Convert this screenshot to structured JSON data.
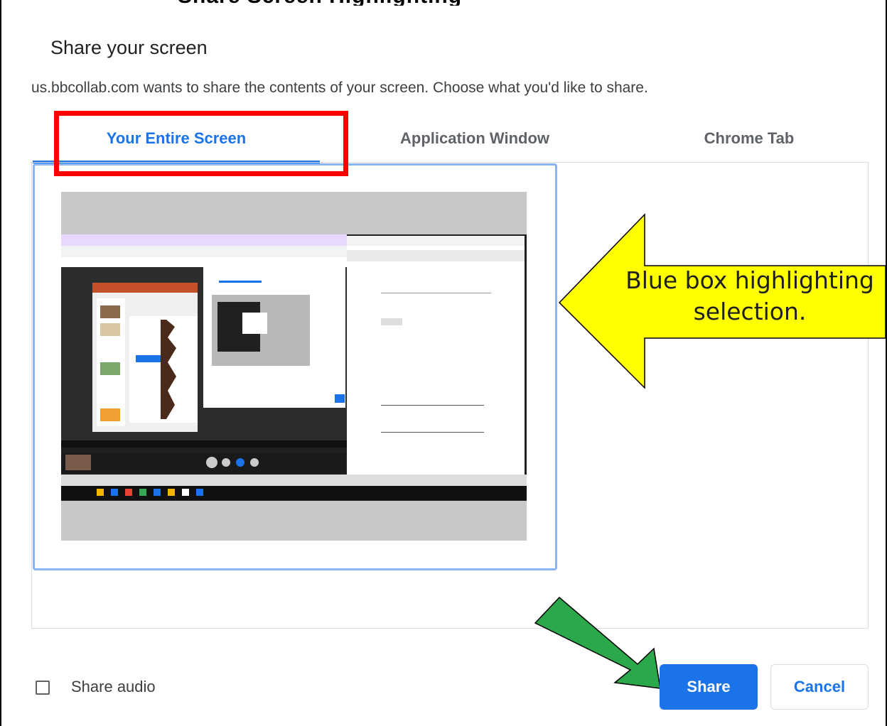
{
  "header": {
    "cut_off_heading": "Share Screen Highlighting"
  },
  "dialog": {
    "title": "Share your screen",
    "description": "us.bbcollab.com wants to share the contents of your screen. Choose what you'd like to share.",
    "tabs": [
      {
        "label": "Your Entire Screen",
        "active": true
      },
      {
        "label": "Application Window",
        "active": false
      },
      {
        "label": "Chrome Tab",
        "active": false
      }
    ],
    "share_audio_label": "Share audio",
    "share_audio_checked": false,
    "share_button": "Share",
    "cancel_button": "Cancel"
  },
  "annotations": {
    "callout_line1": "Blue box highlighting",
    "callout_line2": "selection.",
    "callout_color": "#ffff00",
    "highlight_color": "#ff0000",
    "arrow_color": "#2aa84a"
  },
  "colors": {
    "accent": "#1a73e8",
    "selection_border": "#8ab4f8",
    "divider": "#dadce0"
  }
}
